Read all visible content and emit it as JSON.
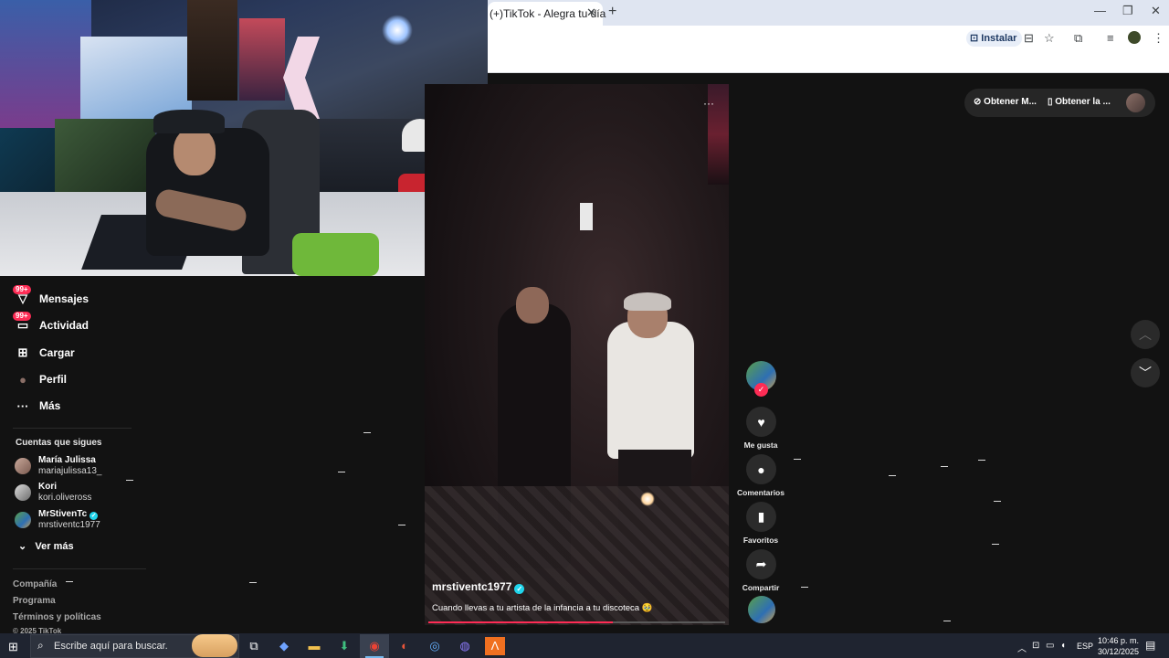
{
  "browser": {
    "tab_title": "(+)TikTok - Alegra tu día",
    "tab_close": "✕",
    "new_tab": "+",
    "install_label": "Instalar",
    "window_minimize": "—",
    "window_restore": "❐",
    "window_close": "✕"
  },
  "sidebar": {
    "items": [
      {
        "label": "Mensajes",
        "icon": "paper-plane-icon",
        "glyph": "▽",
        "badge": "99+"
      },
      {
        "label": "Actividad",
        "icon": "inbox-icon",
        "glyph": "▭",
        "badge": "99+"
      },
      {
        "label": "Cargar",
        "icon": "upload-icon",
        "glyph": "⊞",
        "badge": ""
      },
      {
        "label": "Perfil",
        "icon": "avatar-icon",
        "glyph": "●",
        "badge": ""
      },
      {
        "label": "Más",
        "icon": "more-icon",
        "glyph": "···",
        "badge": ""
      }
    ],
    "following_title": "Cuentas que sigues",
    "following": [
      {
        "name": "María Julissa",
        "handle": "mariajulissa13_",
        "verified": false
      },
      {
        "name": "Kori",
        "handle": "kori.oliveross",
        "verified": false
      },
      {
        "name": "MrStivenTc",
        "handle": "mrstiventc1977",
        "verified": true
      }
    ],
    "see_more": "Ver más",
    "footer": [
      "Compañía",
      "Programa",
      "Términos y políticas",
      "© 2025 TikTok"
    ]
  },
  "video": {
    "author": "mrstiventc1977",
    "caption": "Cuando llevas a tu artista de la infancia a tu discoteca 🥹",
    "progress": 0.62
  },
  "actions": [
    {
      "label": "Me gusta",
      "icon": "heart-icon",
      "glyph": "♥"
    },
    {
      "label": "Comentarios",
      "icon": "comment-icon",
      "glyph": "●"
    },
    {
      "label": "Favoritos",
      "icon": "bookmark-icon",
      "glyph": "▮"
    },
    {
      "label": "Compartir",
      "icon": "share-icon",
      "glyph": "➦"
    }
  ],
  "top_right": {
    "get_app_1": "Obtener M...",
    "get_app_2": "Obtener la ..."
  },
  "taskbar": {
    "search_placeholder": "Escribe aquí para buscar.",
    "language": "ESP",
    "time": "10:46 p. m.",
    "date": "30/12/2025"
  },
  "colors": {
    "accent": "#fe2c55",
    "verified": "#20d5ec",
    "background": "#121212"
  }
}
